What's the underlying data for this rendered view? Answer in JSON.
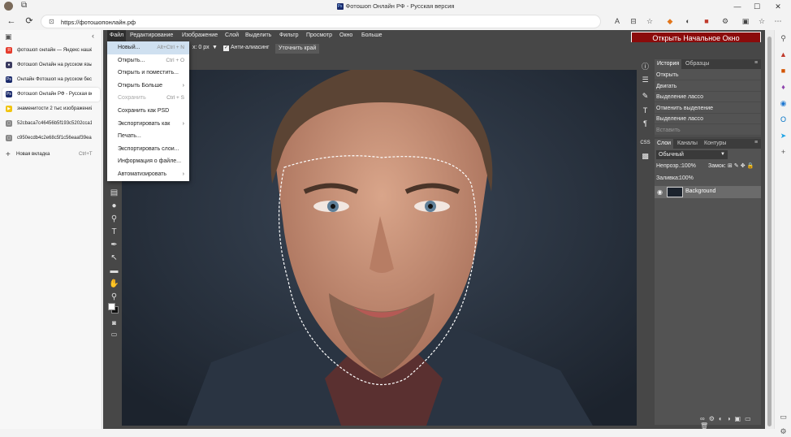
{
  "window": {
    "title": "Фотошоп Онлайн РФ - Русская версия",
    "min": "—",
    "max": "☐",
    "close": "✕"
  },
  "browser": {
    "url": "https://фотошопонлайн.рф",
    "back": "←",
    "reload": "⟳"
  },
  "tabs": [
    {
      "label": "фотошоп онлайн — Яндекс нашёл",
      "fav_color": "#e53b2c",
      "fav": "Я"
    },
    {
      "label": "Фотошоп Онлайн на русском языке",
      "fav_color": "#3b3b60",
      "fav": "●"
    },
    {
      "label": "Онлайн Фотошоп на русском бесплатно",
      "fav_color": "#1a2a6b",
      "fav": "Ps"
    },
    {
      "label": "Фотошоп Онлайн РФ - Русская версия",
      "fav_color": "#1a2a6b",
      "fav": "Ps"
    },
    {
      "label": "знаменитости 2 тыс изображений",
      "fav_color": "#f1c40f",
      "fav": "▶"
    },
    {
      "label": "52cbaca7c46456b5f193c5202cca1",
      "fav_color": "#888",
      "fav": "▢"
    },
    {
      "label": "c950ecdb4c2e68c5f1c56eaaf39ea",
      "fav_color": "#888",
      "fav": "▢"
    }
  ],
  "new_tab": {
    "label": "Новая вкладка",
    "shortcut": "Ctrl+T"
  },
  "menu": [
    "Файл",
    "Редактирование",
    "Изображение",
    "Слой",
    "Выделить",
    "Фильтр",
    "Просмотр",
    "Окно",
    "Больше"
  ],
  "open_start": "Открыть Начальное Окно",
  "options": {
    "feather_value": "x: 0 px",
    "antialias": "Анти-алиасинг",
    "refine": "Уточнить край"
  },
  "file_menu": [
    {
      "label": "Новый...",
      "shortcut": "Alt+Ctrl + N"
    },
    {
      "label": "Открыть...",
      "shortcut": "Ctrl + O"
    },
    {
      "label": "Открыть и поместить...",
      "shortcut": ""
    },
    {
      "label": "Открыть Больше",
      "shortcut": ""
    },
    {
      "label": "Сохранить",
      "shortcut": "Ctrl + S"
    },
    {
      "label": "Сохранить как PSD",
      "shortcut": ""
    },
    {
      "label": "Экспортировать как",
      "shortcut": ""
    },
    {
      "label": "Печать...",
      "shortcut": ""
    },
    {
      "label": "Экспортировать слои...",
      "shortcut": ""
    },
    {
      "label": "Информация о файле...",
      "shortcut": ""
    },
    {
      "label": "Автоматизировать",
      "shortcut": ""
    }
  ],
  "history": {
    "tab1": "История",
    "tab2": "Образцы",
    "items": [
      "Открыть",
      "Двигать",
      "Выделение лассо",
      "Отменить выделение",
      "Выделение лассо",
      "Вставить"
    ]
  },
  "layers": {
    "tab1": "Слои",
    "tab2": "Каналы",
    "tab3": "Контуры",
    "blend": "Обычный",
    "opacity_label": "Непрозр.:",
    "opacity": "100%",
    "lock_label": "Замок:",
    "fill_label": "Заливка:",
    "fill": "100%",
    "layer_name": "Background"
  },
  "side_icons": {
    "css": "CSS"
  }
}
